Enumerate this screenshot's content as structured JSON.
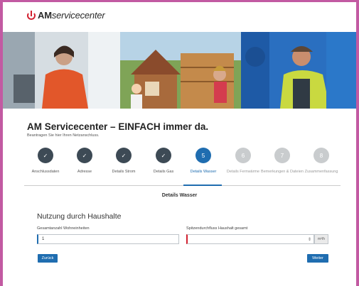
{
  "brand": {
    "prefix": "AM",
    "suffix": "servicecenter"
  },
  "page": {
    "title": "AM Servicecenter – EINFACH immer da.",
    "subtitle": "Beantragen Sie hier Ihren Netzanschluss."
  },
  "steps": [
    {
      "number": "✓",
      "label": "Anschlussdaten",
      "state": "done"
    },
    {
      "number": "✓",
      "label": "Adresse",
      "state": "done"
    },
    {
      "number": "✓",
      "label": "Details Strom",
      "state": "done"
    },
    {
      "number": "✓",
      "label": "Details Gas",
      "state": "done"
    },
    {
      "number": "5",
      "label": "Details Wasser",
      "state": "current"
    },
    {
      "number": "6",
      "label": "Details Fernwärme",
      "state": "future"
    },
    {
      "number": "7",
      "label": "Bemerkungen & Dateien",
      "state": "future"
    },
    {
      "number": "8",
      "label": "Zusammenfassung",
      "state": "future"
    }
  ],
  "section_title": "Details Wasser",
  "form": {
    "heading": "Nutzung durch Haushalte",
    "units_label": "Gesamtanzahl Wohneinheiten",
    "units_value": "1",
    "peak_label": "Spitzendurchfluss Haushalt gesamt",
    "peak_value": "",
    "peak_unit": "m³/h"
  },
  "buttons": {
    "back": "Zurück",
    "next": "Weiter"
  },
  "colors": {
    "accent": "#1f6db0",
    "done": "#3d4a55",
    "future": "#c9ccce",
    "error": "#d2202f",
    "brand_red": "#d2202f"
  }
}
